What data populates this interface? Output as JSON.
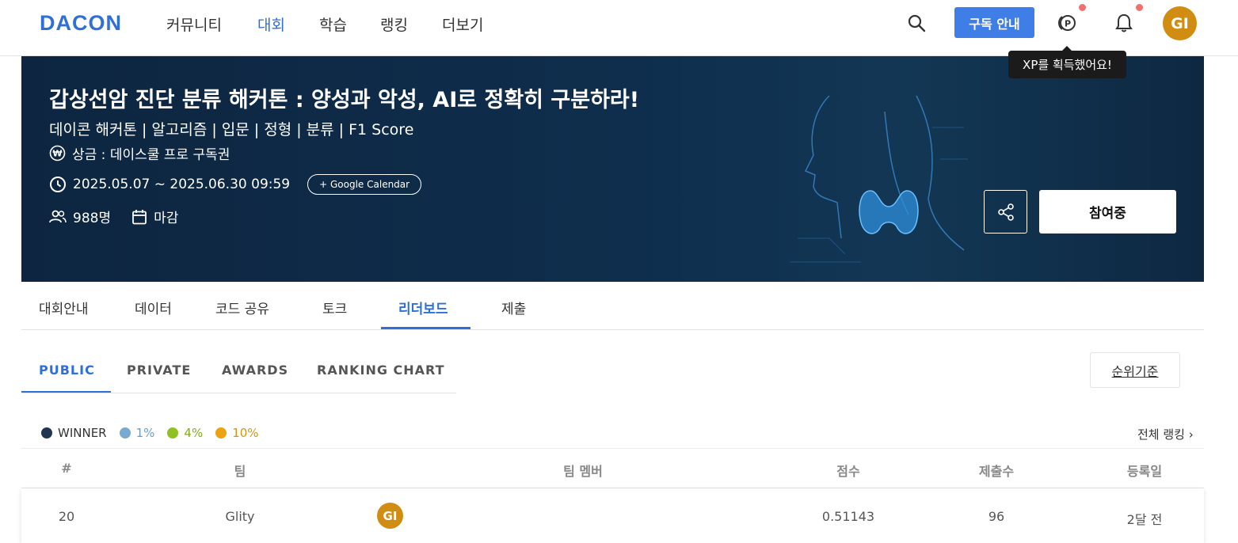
{
  "header": {
    "logo": "DACON",
    "nav": [
      "커뮤니티",
      "대회",
      "학습",
      "랭킹",
      "더보기"
    ],
    "active_nav": 1,
    "subscribe_label": "구독 안내",
    "avatar_initials": "GI",
    "tooltip": "XP를 획득했어요!",
    "accent_color": "#2f6fd6",
    "avatar_color": "#d18d12",
    "notification_dot_color": "#f07070"
  },
  "banner": {
    "title": "갑상선암 진단 분류 해커톤 : 양성과 악성, AI로 정확히 구분하라!",
    "tags": "데이콘 해커톤 | 알고리즘 | 입문 | 정형 | 분류 | F1 Score",
    "prize": "상금 : 데이스쿨 프로 구독권",
    "period": "2025.05.07 ~ 2025.06.30 09:59",
    "gcal_label": "+ Google Calendar",
    "participants": "988명",
    "status": "마감",
    "join_label": "참여중"
  },
  "main_tabs": [
    "대회안내",
    "데이터",
    "코드 공유",
    "토크",
    "리더보드",
    "제출"
  ],
  "active_main_tab": 4,
  "sub_tabs": [
    "PUBLIC",
    "PRIVATE",
    "AWARDS",
    "RANKING CHART"
  ],
  "active_sub_tab": 0,
  "rank_criteria_label": "순위기준",
  "legend": [
    {
      "label": "WINNER",
      "color": "#1f3550",
      "text_color": "#333"
    },
    {
      "label": "1%",
      "color": "#7aa9cf",
      "text_color": "#6b9dc6"
    },
    {
      "label": "4%",
      "color": "#8fc121",
      "text_color": "#7fae18"
    },
    {
      "label": "10%",
      "color": "#eba313",
      "text_color": "#d99310"
    }
  ],
  "all_ranking_label": "전체 랭킹 ›",
  "table": {
    "columns": [
      "#",
      "팀",
      "팀 멤버",
      "점수",
      "제출수",
      "등록일"
    ],
    "rows": [
      {
        "rank": "20",
        "team": "Glity",
        "member_initials": "GI",
        "score": "0.51143",
        "submissions": "96",
        "date": "2달 전"
      }
    ]
  }
}
